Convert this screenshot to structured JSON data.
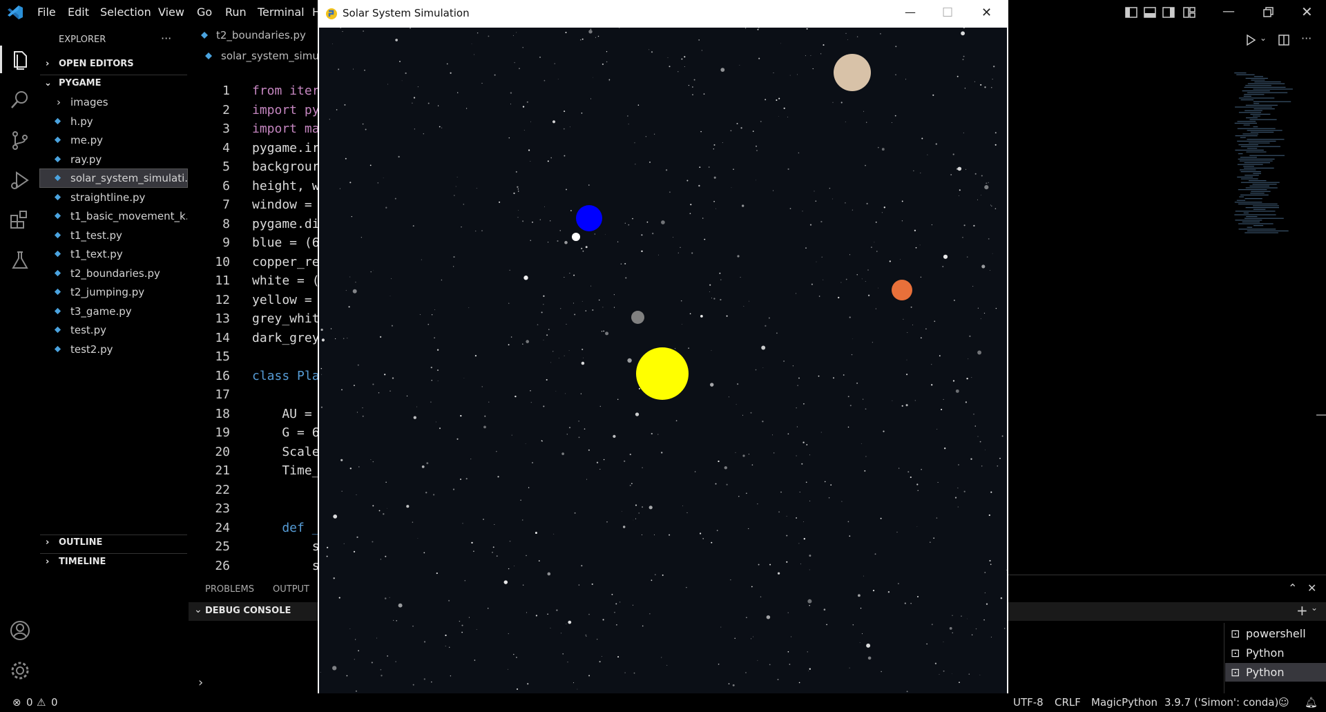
{
  "menu": [
    "File",
    "Edit",
    "Selection",
    "View",
    "Go",
    "Run",
    "Terminal",
    "H"
  ],
  "sidebar": {
    "title": "EXPLORER",
    "more": "···",
    "open_editors": "OPEN EDITORS",
    "folder": "PYGAME",
    "items": [
      {
        "label": "images",
        "type": "folder"
      },
      {
        "label": "h.py",
        "type": "file"
      },
      {
        "label": "me.py",
        "type": "file"
      },
      {
        "label": "ray.py",
        "type": "file"
      },
      {
        "label": "solar_system_simulati...",
        "type": "file",
        "selected": true
      },
      {
        "label": "straightline.py",
        "type": "file"
      },
      {
        "label": "t1_basic_movement_k...",
        "type": "file"
      },
      {
        "label": "t1_test.py",
        "type": "file"
      },
      {
        "label": "t1_text.py",
        "type": "file"
      },
      {
        "label": "t2_boundaries.py",
        "type": "file"
      },
      {
        "label": "t2_jumping.py",
        "type": "file"
      },
      {
        "label": "t3_game.py",
        "type": "file"
      },
      {
        "label": "test.py",
        "type": "file"
      },
      {
        "label": "test2.py",
        "type": "file"
      }
    ],
    "outline": "OUTLINE",
    "timeline": "TIMELINE"
  },
  "editor": {
    "tab": "t2_boundaries.py",
    "breadcrumb": "solar_system_simula",
    "lines": [
      {
        "n": "1",
        "code": "from iter",
        "kw": true
      },
      {
        "n": "2",
        "code": "import py",
        "kw": true
      },
      {
        "n": "3",
        "code": "import ma",
        "kw": true
      },
      {
        "n": "4",
        "code": "pygame.ir"
      },
      {
        "n": "5",
        "code": "backgrour"
      },
      {
        "n": "6",
        "code": "height, w"
      },
      {
        "n": "7",
        "code": "window ="
      },
      {
        "n": "8",
        "code": "pygame.di"
      },
      {
        "n": "9",
        "code": "blue = (6"
      },
      {
        "n": "10",
        "code": "copper_re"
      },
      {
        "n": "11",
        "code": "white = ("
      },
      {
        "n": "12",
        "code": "yellow ="
      },
      {
        "n": "13",
        "code": "grey_whit"
      },
      {
        "n": "14",
        "code": "dark_grey"
      },
      {
        "n": "15",
        "code": ""
      },
      {
        "n": "16",
        "code": "class Pla",
        "kw2": true
      },
      {
        "n": "17",
        "code": ""
      },
      {
        "n": "18",
        "code": "    AU ="
      },
      {
        "n": "19",
        "code": "    G = 6"
      },
      {
        "n": "20",
        "code": "    Scale"
      },
      {
        "n": "21",
        "code": "    Time_"
      },
      {
        "n": "22",
        "code": ""
      },
      {
        "n": "23",
        "code": ""
      },
      {
        "n": "24",
        "code": "    def _",
        "kw2": true
      },
      {
        "n": "25",
        "code": "        s"
      },
      {
        "n": "26",
        "code": "        s"
      }
    ]
  },
  "panel": {
    "tabs": [
      "PROBLEMS",
      "OUTPUT"
    ],
    "debug_console": "DEBUG CONSOLE"
  },
  "pygame_window": {
    "title": "Solar System Simulation",
    "minimize": "—",
    "maximize": "☐",
    "close": "✕"
  },
  "terminals": [
    "powershell",
    "Python",
    "Python"
  ],
  "status": {
    "errors": "0",
    "warnings": "0",
    "encoding": "UTF-8",
    "eol": "CRLF",
    "language": "MagicPython",
    "interpreter": "3.9.7 ('Simon': conda)"
  },
  "colors": {
    "sun": "#ffff00",
    "blue_planet": "#0000ff",
    "grey_planet": "#808080",
    "copper_planet": "#e8703a",
    "beige_planet": "#d8c2a8",
    "moon": "#ffffff",
    "keyword": "#c586c0",
    "keyword2": "#569cd6",
    "accent": "#0e639c"
  }
}
